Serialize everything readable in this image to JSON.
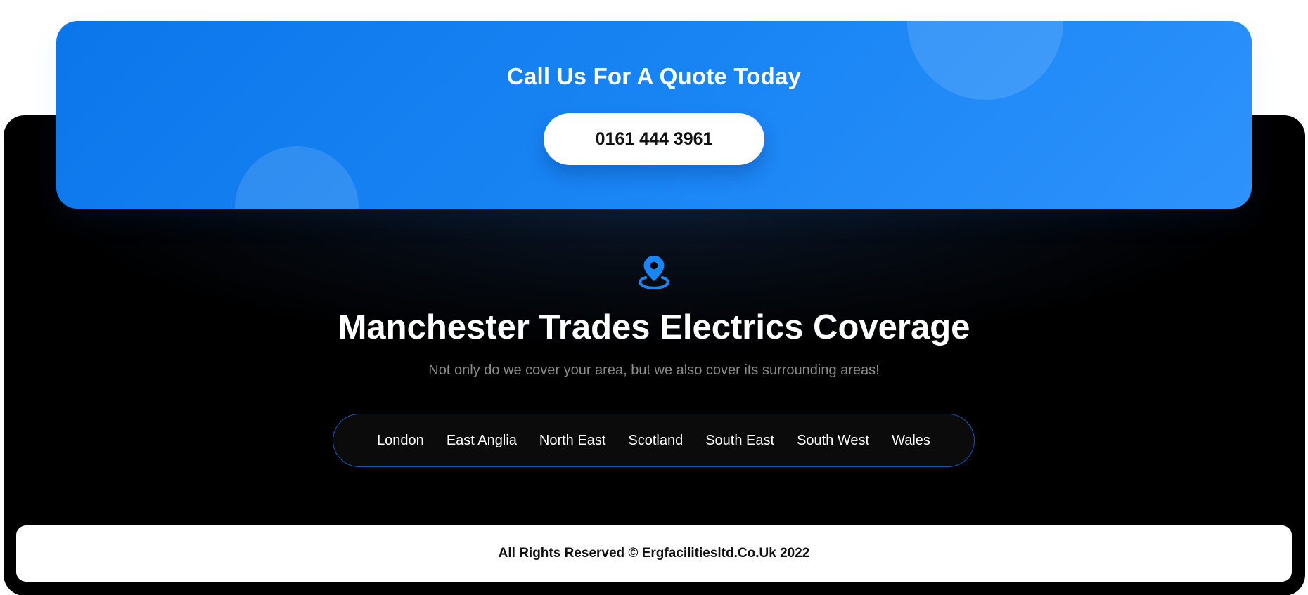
{
  "quote": {
    "title": "Call Us For A Quote Today",
    "phone": "0161 444 3961"
  },
  "coverage": {
    "icon": "map-pin-icon",
    "title": "Manchester Trades Electrics Coverage",
    "subtitle": "Not only do we cover your area, but we also cover its surrounding areas!",
    "regions": [
      "London",
      "East Anglia",
      "North East",
      "Scotland",
      "South East",
      "South West",
      "Wales"
    ]
  },
  "footer": {
    "text": "All Rights Reserved © Ergfacilitiesltd.Co.Uk 2022"
  },
  "colors": {
    "accent_blue": "#1a86f5",
    "background_dark": "#000000",
    "subtitle_gray": "#8c8c8c",
    "region_border": "#1656b8"
  }
}
